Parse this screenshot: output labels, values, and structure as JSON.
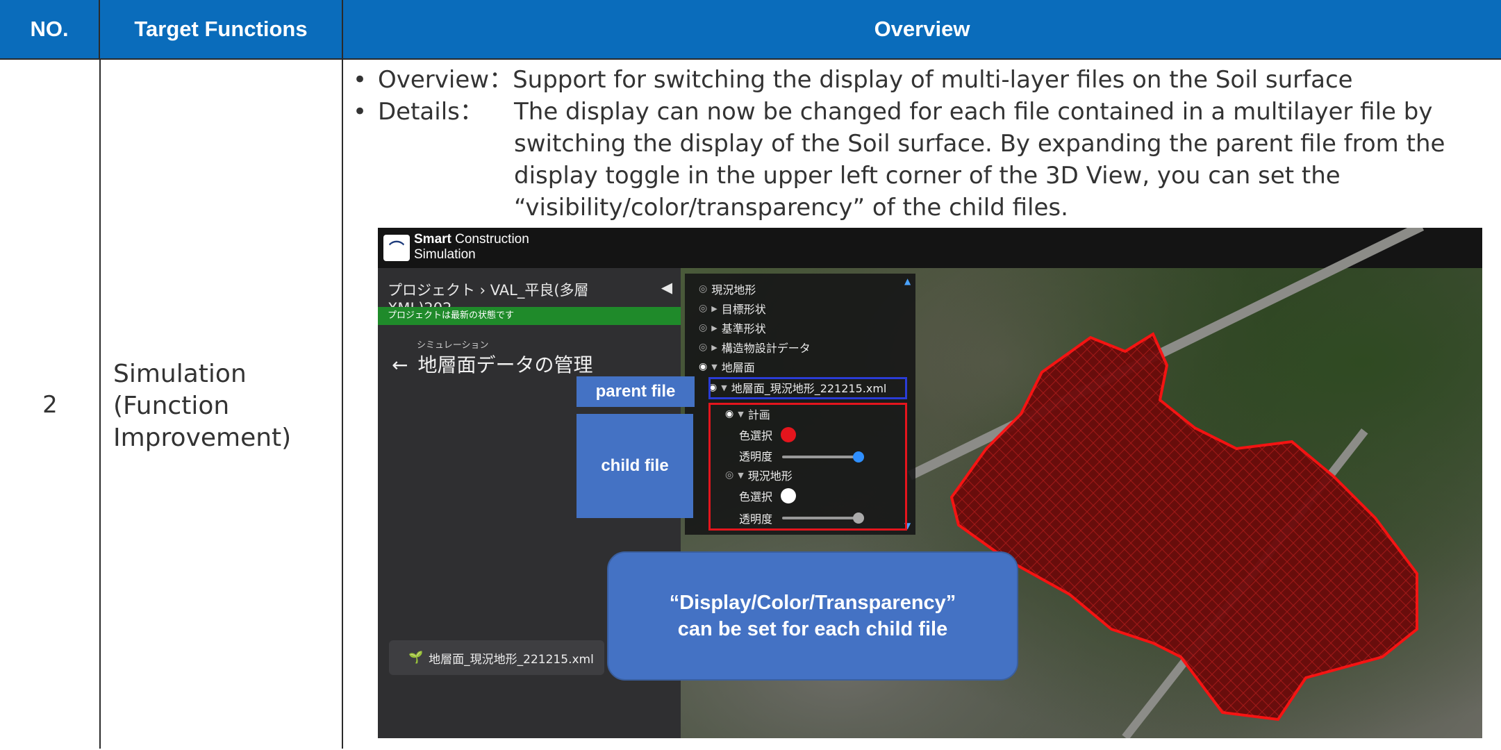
{
  "table": {
    "headers": {
      "no": "NO.",
      "target": "Target Functions",
      "overview": "Overview"
    },
    "row": {
      "no": "2",
      "target_line1": "Simulation",
      "target_line2": "(Function",
      "target_line3": "Improvement)",
      "overview_bullet1": "Overview：Support for switching the display of multi-layer files on the Soil surface",
      "details_label": "Details：",
      "details_line1": "The display can now be changed for each file contained in a multilayer file by",
      "details_line2": "switching the display of the Soil surface. By expanding the parent file from the",
      "details_line3": "display toggle in the upper left corner of the 3D View, you can set the",
      "details_line4": "“visibility/color/transparency” of the child files."
    }
  },
  "app": {
    "logo_bold": "Smart",
    "logo_rest": "Construction",
    "logo_line2": "Simulation",
    "breadcrumb": "プロジェクト › VAL_平良(多層XML)202...",
    "status": "プロジェクトは最新の状態です",
    "section_small": "シミュレーション",
    "section_title": "地層面データの管理",
    "file_chip": "地層面_現況地形_221215.xml",
    "layers": {
      "current_terrain": "現況地形",
      "target_shape": "目標形状",
      "reference_shape": "基準形状",
      "structure_data": "構造物設計データ",
      "strata": "地層面",
      "parent_file": "地層面_現況地形_221215.xml",
      "child1": "計画",
      "color_select": "色選択",
      "transparency": "透明度",
      "child2": "現況地形",
      "color_select2": "色選択",
      "transparency2": "透明度"
    },
    "child1_color": "#e4151d",
    "child2_color": "#ffffff",
    "child1_opacity_pct": 100,
    "child2_opacity_pct": 100
  },
  "callouts": {
    "parent": "parent file",
    "child": "child file",
    "big_line1": "“Display/Color/Transparency”",
    "big_line2": "can be set for each child file"
  }
}
